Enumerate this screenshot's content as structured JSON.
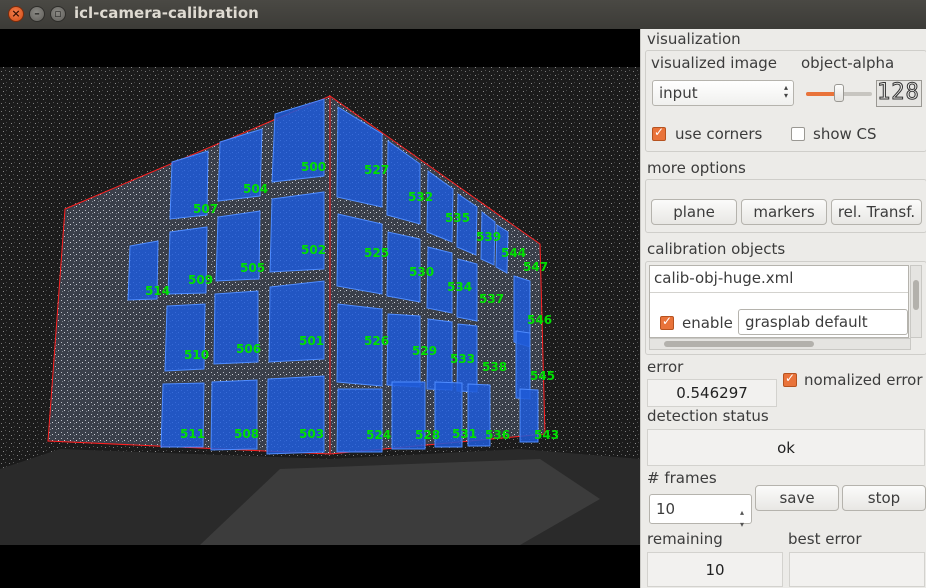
{
  "window": {
    "title": "icl-camera-calibration"
  },
  "marker_ids": [
    "500",
    "527",
    "504",
    "532",
    "507",
    "535",
    "539",
    "544",
    "547",
    "502",
    "525",
    "530",
    "514",
    "509",
    "505",
    "534",
    "537",
    "546",
    "501",
    "526",
    "529",
    "533",
    "538",
    "510",
    "506",
    "545",
    "511",
    "508",
    "503",
    "524",
    "528",
    "531",
    "536",
    "543"
  ],
  "visualization": {
    "section_label": "visualization",
    "image_label": "visualized image",
    "image_value": "input",
    "alpha_label": "object-alpha",
    "alpha_value": "128",
    "alpha_fraction": 0.5,
    "use_corners_label": "use corners",
    "use_corners_checked": true,
    "show_cs_label": "show CS",
    "show_cs_checked": false
  },
  "more_options": {
    "label": "more options",
    "plane": "plane",
    "markers": "markers",
    "rel_transf": "rel. Transf."
  },
  "calibration_objects": {
    "label": "calibration objects",
    "file": "calib-obj-huge.xml",
    "enable_label": "enable",
    "enable_checked": true,
    "preset": "grasplab default"
  },
  "error": {
    "label": "error",
    "value": "0.546297",
    "normalized_label": "nomalized error",
    "normalized_checked": true
  },
  "detection": {
    "label": "detection status",
    "value": "ok"
  },
  "frames": {
    "label": "# frames",
    "value": "10",
    "save": "save",
    "stop": "stop"
  },
  "remaining": {
    "label": "remaining",
    "value": "10"
  },
  "best_error": {
    "label": "best error",
    "value": ""
  },
  "colors": {
    "accent": "#e9733a",
    "marker_fill": "#1e5bd8",
    "marker_label": "#00e000",
    "contour": "#ff2020"
  }
}
